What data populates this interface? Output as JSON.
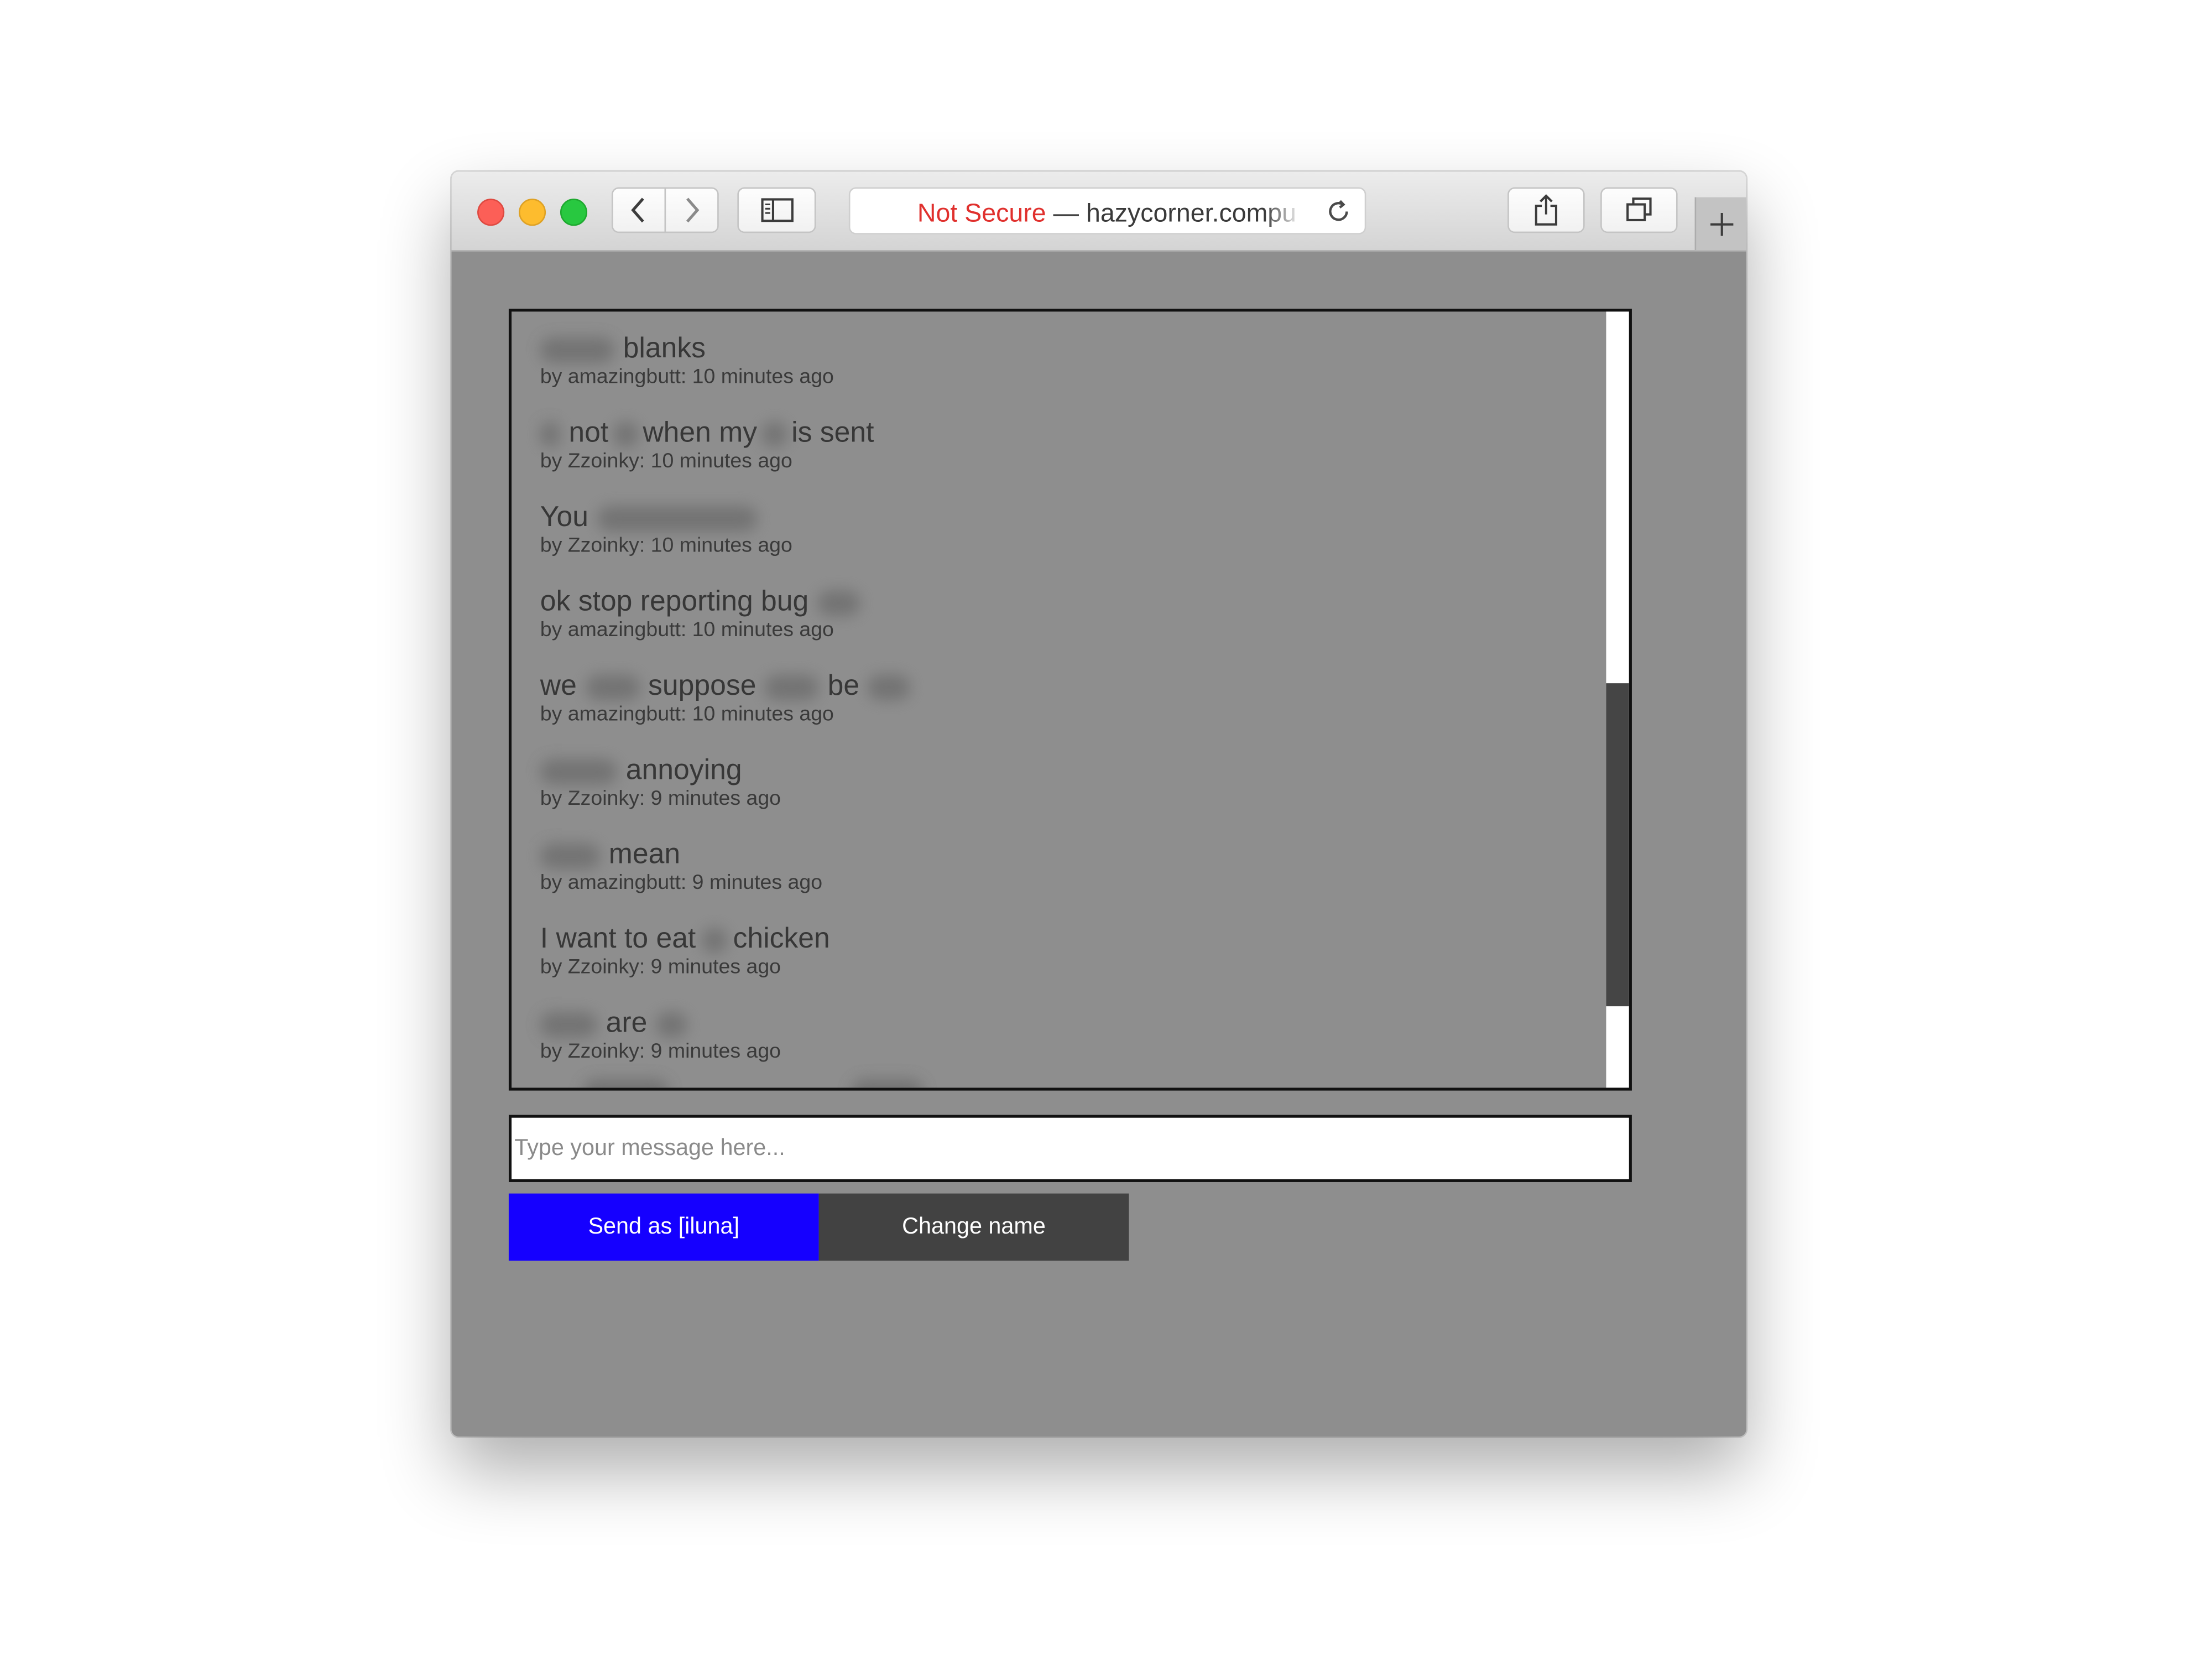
{
  "browser": {
    "address_security": "Not Secure",
    "address_separator": " — ",
    "address_host": "hazycorner.compu",
    "icons": {
      "back": "chevron-left-icon",
      "forward": "chevron-right-icon",
      "sidebar": "sidebar-icon",
      "reload": "reload-icon",
      "share": "share-icon",
      "tabs": "tabs-overview-icon",
      "new_tab": "plus-icon"
    }
  },
  "chat": {
    "messages": [
      {
        "text_parts": [
          "blanks"
        ],
        "meta": "by amazingbutt: 10 minutes ago"
      },
      {
        "text_parts": [
          "not",
          "when my",
          "is sent"
        ],
        "meta": "by Zzoinky: 10 minutes ago"
      },
      {
        "text_parts": [
          "You"
        ],
        "meta": "by Zzoinky: 10 minutes ago"
      },
      {
        "text_parts": [
          "ok stop reporting bug"
        ],
        "meta": "by amazingbutt: 10 minutes ago"
      },
      {
        "text_parts": [
          "we",
          "suppose",
          "be"
        ],
        "meta": "by amazingbutt: 10 minutes ago"
      },
      {
        "text_parts": [
          "annoying"
        ],
        "meta": "by Zzoinky: 9 minutes ago"
      },
      {
        "text_parts": [
          "mean"
        ],
        "meta": "by amazingbutt: 9 minutes ago"
      },
      {
        "text_parts": [
          "I want to eat",
          "chicken"
        ],
        "meta": "by Zzoinky: 9 minutes ago"
      },
      {
        "text_parts": [
          "are"
        ],
        "meta": "by Zzoinky: 9 minutes ago"
      }
    ]
  },
  "composer": {
    "placeholder": "Type your message here...",
    "value": ""
  },
  "actions": {
    "send_label": "Send as [iluna]",
    "change_name_label": "Change name"
  },
  "colors": {
    "page_background": "#8e8e8e",
    "send_button": "#1500ff",
    "change_name_button": "#424242",
    "not_secure": "#e0302d"
  }
}
